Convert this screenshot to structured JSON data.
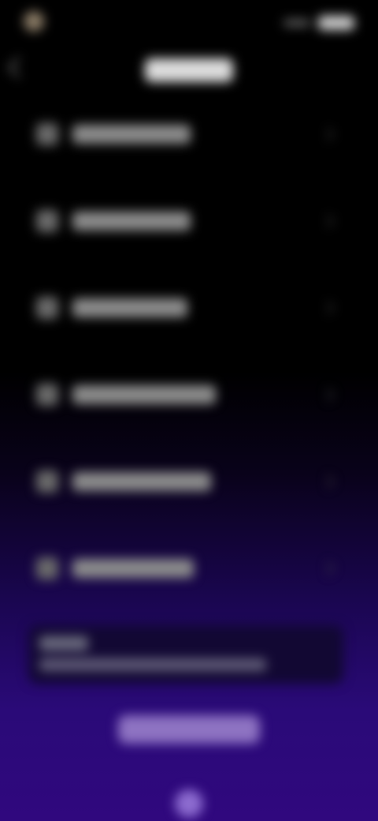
{
  "status_bar": {
    "time": "",
    "indicator_icon": "avatar-dot-icon",
    "battery_icon": "battery-icon",
    "signal_icon": "signal-icon"
  },
  "header": {
    "title": "",
    "back_icon": "chevron-left-icon"
  },
  "menu": {
    "items": [
      {
        "label": "",
        "icon": "list-item-icon"
      },
      {
        "label": "",
        "icon": "list-item-icon"
      },
      {
        "label": "",
        "icon": "list-item-icon"
      },
      {
        "label": "",
        "icon": "list-item-icon"
      },
      {
        "label": "",
        "icon": "list-item-icon"
      },
      {
        "label": "",
        "icon": "list-item-icon"
      }
    ]
  },
  "info_box": {
    "badge": "",
    "text": ""
  },
  "action": {
    "button_label": ""
  },
  "colors": {
    "background_top": "#000000",
    "background_bottom": "#30087e",
    "accent": "#8e73c2"
  }
}
